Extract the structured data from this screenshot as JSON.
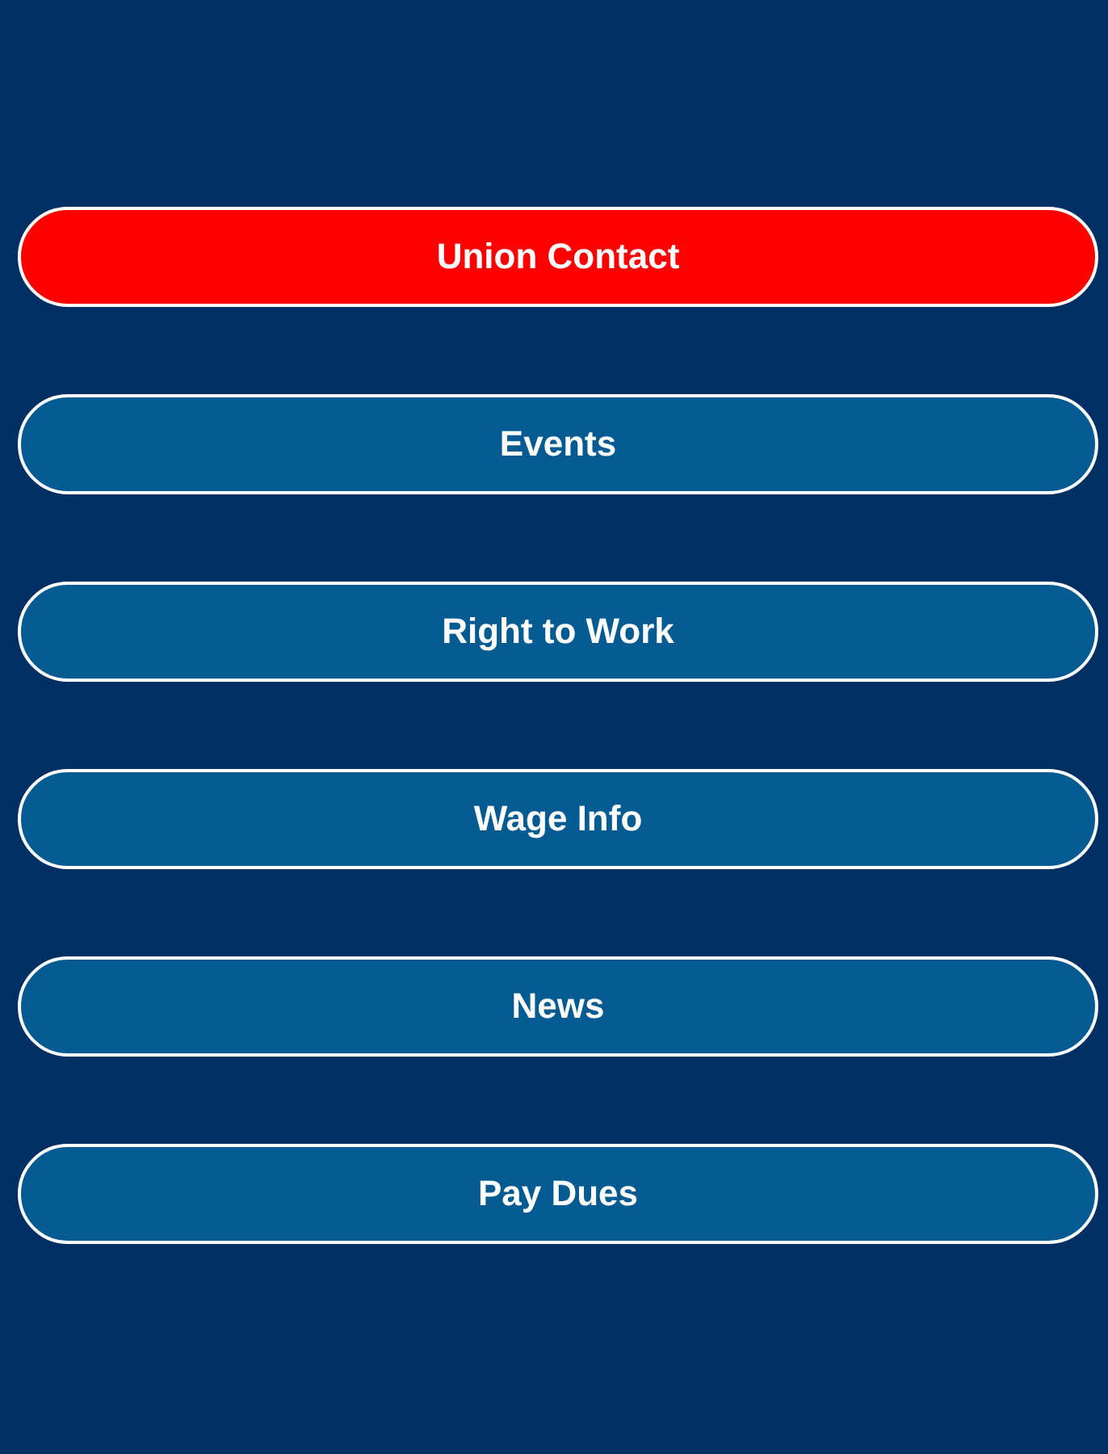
{
  "menu": [
    {
      "label": "Union Contact",
      "color": "#ff0000"
    },
    {
      "label": "Events",
      "color": "#045b92"
    },
    {
      "label": "Right to Work",
      "color": "#045b92"
    },
    {
      "label": "Wage Info",
      "color": "#045b92"
    },
    {
      "label": "News",
      "color": "#045b92"
    },
    {
      "label": "Pay Dues",
      "color": "#045b92"
    }
  ]
}
